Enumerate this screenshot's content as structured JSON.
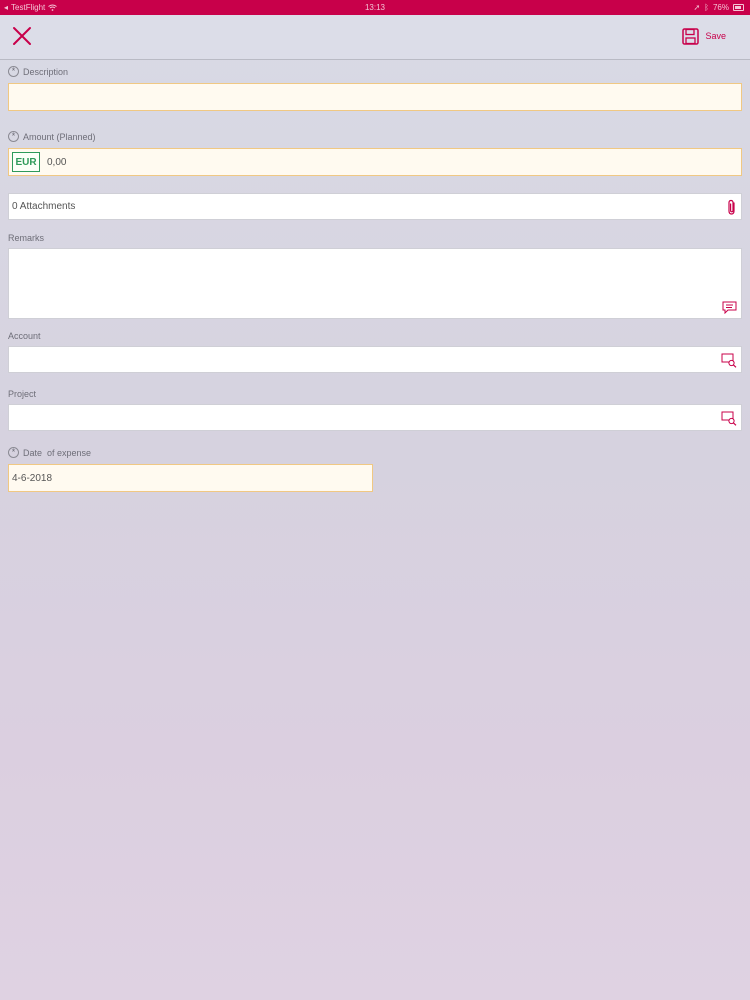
{
  "status_bar": {
    "carrier": "TestFlight",
    "time": "13:13",
    "battery": "76%"
  },
  "toolbar": {
    "close_icon": "close-icon",
    "save_label": "Save",
    "save_icon": "floppy-disk-icon",
    "accent_color": "#c8004a"
  },
  "form": {
    "description": {
      "label": "Description",
      "value": "",
      "required": true
    },
    "amount": {
      "label": "Amount (Planned)",
      "currency": "EUR",
      "value": "0,00",
      "required": true
    },
    "attachments": {
      "value": "0 Attachments",
      "icon": "paperclip-icon"
    },
    "remarks": {
      "label": "Remarks",
      "value": "",
      "icon": "speech-bubble-icon"
    },
    "account": {
      "label": "Account",
      "value": "",
      "icon": "lookup-search-icon"
    },
    "project": {
      "label": "Project",
      "value": "",
      "icon": "lookup-search-icon"
    },
    "date_of_expense": {
      "label": "Date  of expense",
      "value": "4-6-2018",
      "required": true
    }
  }
}
